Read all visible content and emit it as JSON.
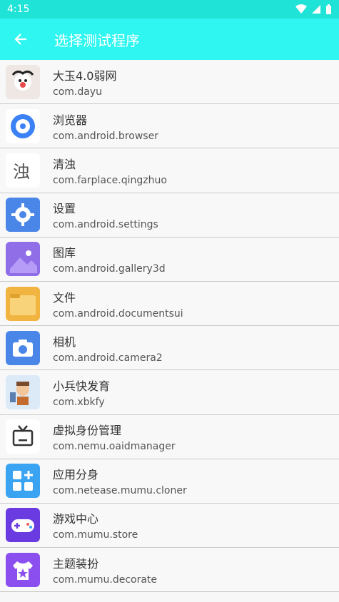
{
  "status": {
    "time": "4:15"
  },
  "toolbar": {
    "title": "选择测试程序"
  },
  "apps": [
    {
      "name": "大玉4.0弱网",
      "pkg": "com.dayu",
      "icon": "avatar-cow-icon",
      "color": "#efe7e4"
    },
    {
      "name": "浏览器",
      "pkg": "com.android.browser",
      "icon": "browser-icon",
      "color": "#ffffff"
    },
    {
      "name": "清浊",
      "pkg": "com.farplace.qingzhuo",
      "icon": "qingzhuo-icon",
      "color": "#ffffff"
    },
    {
      "name": "设置",
      "pkg": "com.android.settings",
      "icon": "settings-gear-icon",
      "color": "#4a86e8"
    },
    {
      "name": "图库",
      "pkg": "com.android.gallery3d",
      "icon": "gallery-icon",
      "color": "#8f6ee8"
    },
    {
      "name": "文件",
      "pkg": "com.android.documentsui",
      "icon": "folder-icon",
      "color": "#f2b441"
    },
    {
      "name": "相机",
      "pkg": "com.android.camera2",
      "icon": "camera-icon",
      "color": "#4a86e8"
    },
    {
      "name": "小兵快发育",
      "pkg": "com.xbkfy",
      "icon": "soldier-game-icon",
      "color": "#dceaf8"
    },
    {
      "name": "虚拟身份管理",
      "pkg": "com.nemu.oaidmanager",
      "icon": "tv-icon",
      "color": "#ffffff"
    },
    {
      "name": "应用分身",
      "pkg": "com.netease.mumu.cloner",
      "icon": "app-cloner-icon",
      "color": "#3aa4f2"
    },
    {
      "name": "游戏中心",
      "pkg": "com.mumu.store",
      "icon": "gamepad-icon",
      "color": "#6a3be0"
    },
    {
      "name": "主题装扮",
      "pkg": "com.mumu.decorate",
      "icon": "theme-shirt-icon",
      "color": "#8b4ff0"
    }
  ]
}
